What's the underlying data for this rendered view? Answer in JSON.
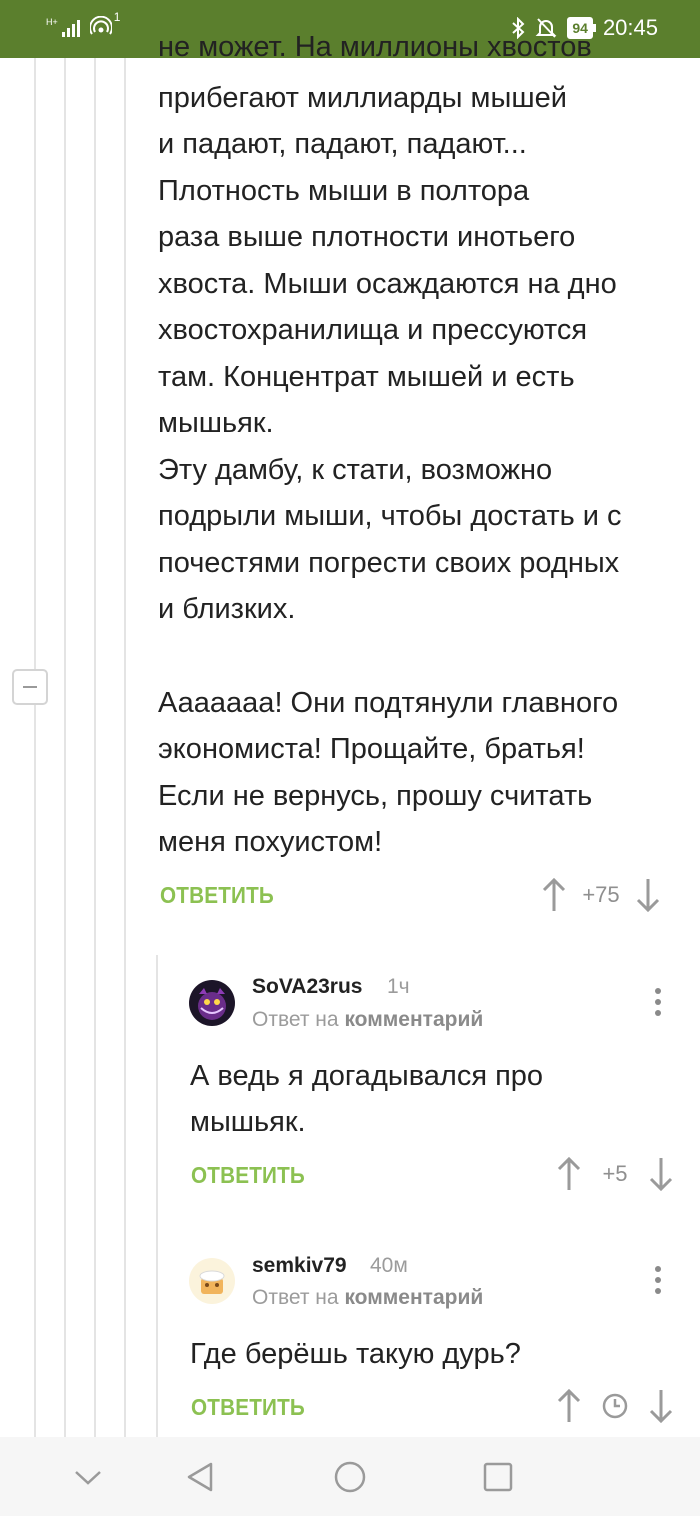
{
  "status_bar": {
    "network": "H+",
    "wifi_badge": "1",
    "battery": "94",
    "time": "20:45"
  },
  "post": {
    "cut_top_line": "не может. На миллионы хвостов",
    "lines_p1": [
      "прибегают миллиарды мышей",
      "и падают, падают, падают...",
      "Плотность мыши в полтора",
      "раза выше плотности инотьего",
      "хвоста. Мыши осаждаются на дно",
      "хвостохранилища и прессуются",
      "там. Концентрат мышей и есть",
      "мышьяк.",
      "Эту дамбу, к стати, возможно",
      "подрыли мыши, чтобы достать и с",
      "почестями погрести своих родных",
      "и близких."
    ],
    "lines_p2": [
      "Ааааааа! Они подтянули главного",
      "экономиста! Прощайте, братья!",
      "Если не вернусь, прошу считать",
      "меня похуистом!"
    ],
    "reply_label": "ОТВЕТИТЬ",
    "score": "+75"
  },
  "comments": [
    {
      "author": "SoVA23rus",
      "time": "1ч",
      "reply_prefix": "Ответ на",
      "reply_target": "комментарий",
      "lines": [
        "А ведь я догадывался про",
        "мышьяк."
      ],
      "reply_label": "ОТВЕТИТЬ",
      "score": "+5"
    },
    {
      "author": "semkiv79",
      "time": "40м",
      "reply_prefix": "Ответ на",
      "reply_target": "комментарий",
      "lines": [
        "Где берёшь такую дурь?"
      ],
      "reply_label": "ОТВЕТИТЬ",
      "score_icon": "clock-icon"
    }
  ],
  "colors": {
    "status_bar": "#5b7f2d",
    "accent_green": "#8cc152",
    "muted": "#9b9b9b"
  },
  "nav_icons": [
    "chevron-down-icon",
    "back-triangle-icon",
    "home-circle-icon",
    "recents-square-icon"
  ]
}
